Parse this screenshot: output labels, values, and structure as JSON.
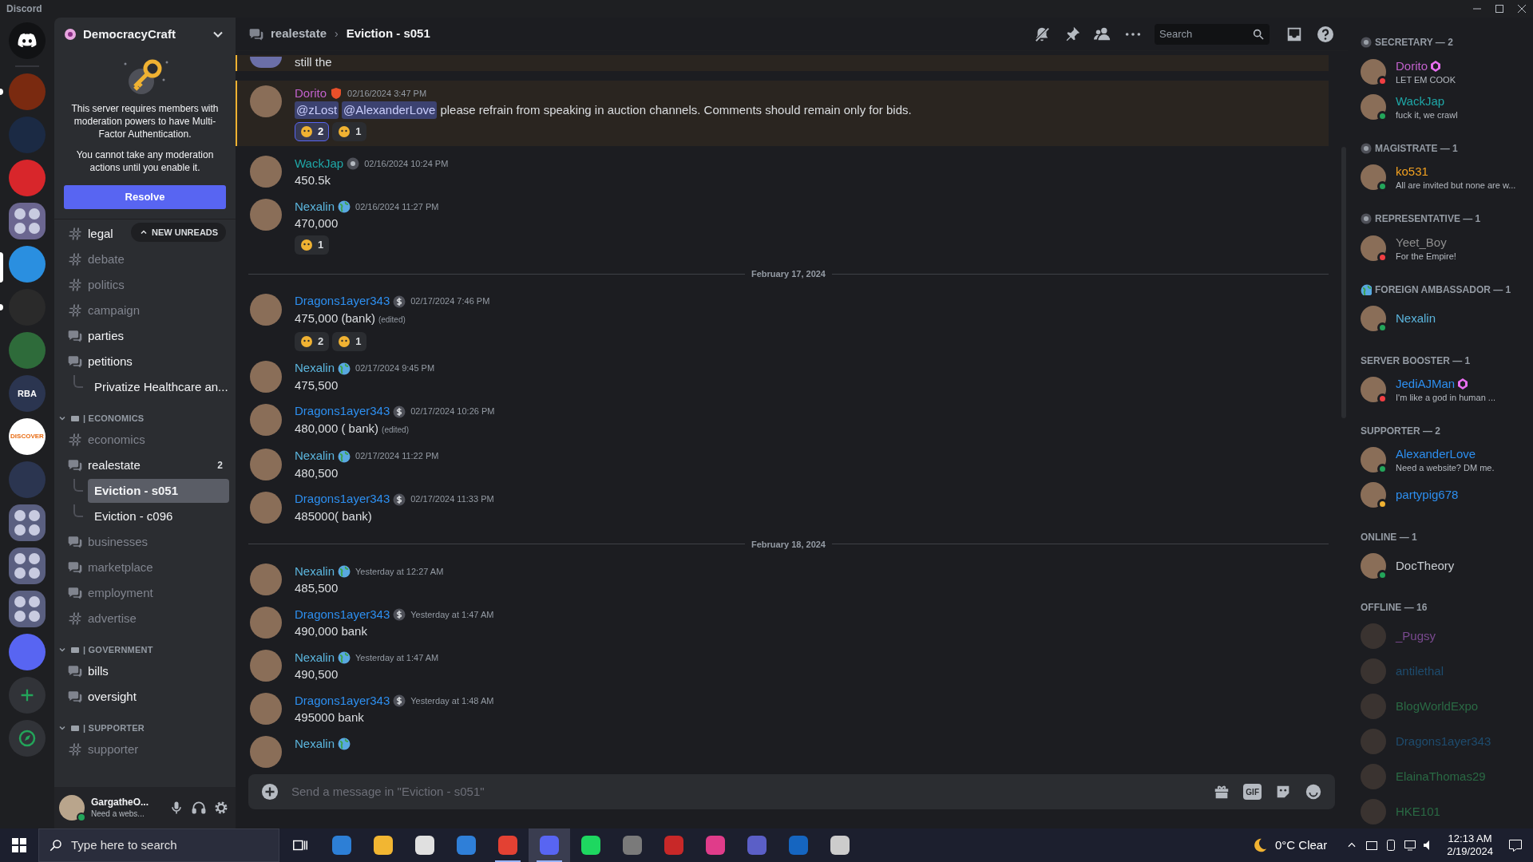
{
  "window": {
    "title": "Discord"
  },
  "servers": [
    {
      "color": "#7a2a10",
      "selected": false,
      "unread": true
    },
    {
      "color": "#1b2a44",
      "selected": false,
      "unread": false
    },
    {
      "color": "#d8262b",
      "selected": false,
      "unread": false
    },
    {
      "color": "#6b6690",
      "selected": false,
      "unread": false,
      "kind": "folder"
    },
    {
      "color": "#2a8fe0",
      "selected": true,
      "unread": false
    },
    {
      "color": "#2a2a2a",
      "selected": false,
      "unread": true
    },
    {
      "color": "#2e6b3a",
      "selected": false,
      "unread": false
    },
    {
      "color": "#2b3550",
      "selected": false,
      "unread": false,
      "label": "RBA"
    },
    {
      "color": "#ffffff",
      "selected": false,
      "unread": false,
      "label": "DISCOVER"
    },
    {
      "color": "#2b3550",
      "selected": false,
      "unread": false
    },
    {
      "color": "#5a5f80",
      "selected": false,
      "unread": false,
      "kind": "folder"
    },
    {
      "color": "#5a5f80",
      "selected": false,
      "unread": false,
      "kind": "folder"
    },
    {
      "color": "#5a5f80",
      "selected": false,
      "unread": false,
      "kind": "folder"
    },
    {
      "color": "#5865f2",
      "selected": false,
      "unread": false
    }
  ],
  "server": {
    "name": "DemocracyCraft",
    "notice": {
      "text": "This server requires members with moderation powers to have Multi-Factor Authentication.",
      "subtext": "You cannot take any moderation actions until you enable it.",
      "button": "Resolve"
    },
    "new_unreads": "NEW UNREADS",
    "channels": [
      {
        "kind": "text",
        "name": "legal",
        "unread": true,
        "selected": false
      },
      {
        "kind": "text",
        "name": "debate",
        "unread": false,
        "selected": false
      },
      {
        "kind": "text",
        "name": "politics",
        "unread": false,
        "selected": false
      },
      {
        "kind": "text",
        "name": "campaign",
        "unread": false,
        "selected": false
      },
      {
        "kind": "forum",
        "name": "parties",
        "unread": true,
        "selected": false
      },
      {
        "kind": "forum",
        "name": "petitions",
        "unread": true,
        "selected": false,
        "children": [
          {
            "name": "Privatize Healthcare an...",
            "unread": true,
            "selected": false
          }
        ]
      }
    ],
    "categories": [
      {
        "name": "| ECONOMICS",
        "expanded": true,
        "channels": [
          {
            "kind": "text",
            "name": "economics",
            "unread": false,
            "selected": false
          },
          {
            "kind": "forum",
            "name": "realestate",
            "unread": true,
            "selected": false,
            "badge": "2",
            "children": [
              {
                "name": "Eviction - s051",
                "unread": true,
                "selected": true
              },
              {
                "name": "Eviction - c096",
                "unread": true,
                "selected": false
              }
            ]
          },
          {
            "kind": "forum",
            "name": "businesses",
            "unread": false,
            "selected": false
          },
          {
            "kind": "forum",
            "name": "marketplace",
            "unread": false,
            "selected": false
          },
          {
            "kind": "forum",
            "name": "employment",
            "unread": false,
            "selected": false
          },
          {
            "kind": "text",
            "name": "advertise",
            "unread": false,
            "selected": false
          }
        ]
      },
      {
        "name": "| GOVERNMENT",
        "expanded": true,
        "channels": [
          {
            "kind": "forum",
            "name": "bills",
            "unread": true,
            "selected": false
          },
          {
            "kind": "forum",
            "name": "oversight",
            "unread": true,
            "selected": false
          }
        ]
      },
      {
        "name": "| SUPPORTER",
        "expanded": true,
        "channels": [
          {
            "kind": "text",
            "name": "supporter",
            "unread": false,
            "selected": false
          }
        ]
      }
    ]
  },
  "user_panel": {
    "name": "GargatheO...",
    "status_text": "Need a webs..."
  },
  "header": {
    "parent": "realestate",
    "separator": "›",
    "channel": "Eviction - s051",
    "search_placeholder": "Search"
  },
  "messages": [
    {
      "kind": "partial",
      "text": "still the"
    },
    {
      "kind": "message",
      "author": "Dorito",
      "color": "#c061cb",
      "badge": {
        "kind": "shield"
      },
      "time": "02/16/2024 3:47 PM",
      "highlighted": true,
      "mentions": [
        "@zLost",
        "@AlexanderLove"
      ],
      "text": "please refrain from speaking in auction channels. Comments should remain only for bids.",
      "reactions": [
        {
          "count": "2",
          "selected": true
        },
        {
          "count": "1",
          "selected": false
        }
      ]
    },
    {
      "kind": "message",
      "author": "WackJap",
      "color": "#1fa7a7",
      "badge": {
        "kind": "gear"
      },
      "time": "02/16/2024 10:24 PM",
      "highlighted": false,
      "text": "450.5k"
    },
    {
      "kind": "message",
      "author": "Nexalin",
      "color": "#5bb5dd",
      "badge": {
        "kind": "globe"
      },
      "time": "02/16/2024 11:27 PM",
      "highlighted": false,
      "text": "470,000",
      "reactions": [
        {
          "count": "1",
          "selected": false
        }
      ]
    },
    {
      "kind": "divider",
      "label": "February 17, 2024"
    },
    {
      "kind": "message",
      "author": "Dragons1ayer343",
      "color": "#2d8ff0",
      "badge": {
        "kind": "coin"
      },
      "time": "02/17/2024 7:46 PM",
      "highlighted": false,
      "text": "475,000 (bank)",
      "edited": "(edited)",
      "reactions": [
        {
          "count": "2",
          "selected": false
        },
        {
          "count": "1",
          "selected": false
        }
      ]
    },
    {
      "kind": "message",
      "author": "Nexalin",
      "color": "#5bb5dd",
      "badge": {
        "kind": "globe"
      },
      "time": "02/17/2024 9:45 PM",
      "highlighted": false,
      "text": "475,500"
    },
    {
      "kind": "message",
      "author": "Dragons1ayer343",
      "color": "#2d8ff0",
      "badge": {
        "kind": "coin"
      },
      "time": "02/17/2024 10:26 PM",
      "highlighted": false,
      "text": "480,000 ( bank)",
      "edited": "(edited)"
    },
    {
      "kind": "message",
      "author": "Nexalin",
      "color": "#5bb5dd",
      "badge": {
        "kind": "globe"
      },
      "time": "02/17/2024 11:22 PM",
      "highlighted": false,
      "text": "480,500"
    },
    {
      "kind": "message",
      "author": "Dragons1ayer343",
      "color": "#2d8ff0",
      "badge": {
        "kind": "coin"
      },
      "time": "02/17/2024 11:33 PM",
      "highlighted": false,
      "text": "485000( bank)"
    },
    {
      "kind": "divider",
      "label": "February 18, 2024"
    },
    {
      "kind": "message",
      "author": "Nexalin",
      "color": "#5bb5dd",
      "badge": {
        "kind": "globe"
      },
      "time": "Yesterday at 12:27 AM",
      "highlighted": false,
      "text": "485,500"
    },
    {
      "kind": "message",
      "author": "Dragons1ayer343",
      "color": "#2d8ff0",
      "badge": {
        "kind": "coin"
      },
      "time": "Yesterday at 1:47 AM",
      "highlighted": false,
      "text": "490,000 bank"
    },
    {
      "kind": "message",
      "author": "Nexalin",
      "color": "#5bb5dd",
      "badge": {
        "kind": "globe"
      },
      "time": "Yesterday at 1:47 AM",
      "highlighted": false,
      "text": "490,500"
    },
    {
      "kind": "message",
      "author": "Dragons1ayer343",
      "color": "#2d8ff0",
      "badge": {
        "kind": "coin"
      },
      "time": "Yesterday at 1:48 AM",
      "highlighted": false,
      "text": "495000 bank"
    },
    {
      "kind": "message",
      "author": "Nexalin",
      "color": "#5bb5dd",
      "badge": {
        "kind": "globe"
      },
      "highlighted": false
    }
  ],
  "composer": {
    "placeholder": "Send a message in \"Eviction - s051\"",
    "gif_label": "GIF"
  },
  "member_groups": [
    {
      "title": "SECRETARY — 2",
      "icon": {
        "kind": "role"
      },
      "members": [
        {
          "name": "Dorito",
          "color": "#c061cb",
          "kind": "dnd",
          "activity": "LET EM COOK",
          "booster": true
        },
        {
          "name": "WackJap",
          "color": "#1fa7a7",
          "kind": "online",
          "activity": "fuck it, we crawl"
        }
      ]
    },
    {
      "title": "MAGISTRATE — 1",
      "icon": {
        "kind": "role"
      },
      "members": [
        {
          "name": "ko531",
          "color": "#f1a020",
          "kind": "online",
          "activity": "All are invited but none are w..."
        }
      ]
    },
    {
      "title": "REPRESENTATIVE — 1",
      "icon": {
        "kind": "role"
      },
      "members": [
        {
          "name": "Yeet_Boy",
          "color": "#8e8e8e",
          "kind": "dnd",
          "activity": "For the Empire!"
        }
      ]
    },
    {
      "title": "FOREIGN AMBASSADOR — 1",
      "icon": {
        "kind": "globe"
      },
      "members": [
        {
          "name": "Nexalin",
          "color": "#5bb5dd",
          "kind": "online"
        }
      ]
    },
    {
      "title": "SERVER BOOSTER — 1",
      "members": [
        {
          "name": "JediAJMan",
          "color": "#2d8ff0",
          "kind": "dnd",
          "activity": "I'm like a god in human ...",
          "booster": true
        }
      ]
    },
    {
      "title": "SUPPORTER — 2",
      "members": [
        {
          "name": "AlexanderLove",
          "color": "#2d8ff0",
          "kind": "online",
          "activity": "Need a website? DM me."
        },
        {
          "name": "partypig678",
          "color": "#2d8ff0",
          "kind": "idle"
        }
      ]
    },
    {
      "title": "ONLINE — 1",
      "members": [
        {
          "name": "DocTheory",
          "color": "#c9cdd2",
          "kind": "online"
        }
      ]
    },
    {
      "title": "OFFLINE — 16",
      "members": [
        {
          "name": "_Pugsy",
          "color": "#7a4a90",
          "kind": "offline"
        },
        {
          "name": "antilethal",
          "color": "#1e4c6e",
          "kind": "offline"
        },
        {
          "name": "BlogWorldExpo",
          "color": "#2a6a44",
          "kind": "offline"
        },
        {
          "name": "Dragons1ayer343",
          "color": "#1e4c6e",
          "kind": "offline"
        },
        {
          "name": "ElainaThomas29",
          "color": "#2a6a44",
          "kind": "offline"
        },
        {
          "name": "HKE101",
          "color": "#2a6a44",
          "kind": "offline"
        }
      ]
    }
  ],
  "taskbar": {
    "search_placeholder": "Type here to search",
    "apps": [
      {
        "color": "#2d7fd6",
        "running": false,
        "selected": false
      },
      {
        "color": "#f2b632",
        "running": false,
        "selected": false
      },
      {
        "color": "#e0e0e0",
        "running": false,
        "selected": false
      },
      {
        "color": "#2f7fd8",
        "running": false,
        "selected": false
      },
      {
        "color": "#e34133",
        "running": true,
        "selected": false
      },
      {
        "color": "#5865f2",
        "running": true,
        "selected": true
      },
      {
        "color": "#1ed760",
        "running": false,
        "selected": false
      },
      {
        "color": "#7a7a7a",
        "running": false,
        "selected": false
      },
      {
        "color": "#c82828",
        "running": false,
        "selected": false
      },
      {
        "color": "#e03c8a",
        "running": false,
        "selected": false
      },
      {
        "color": "#5b5fc7",
        "running": false,
        "selected": false
      },
      {
        "color": "#1565c0",
        "running": false,
        "selected": false
      },
      {
        "color": "#cccccc",
        "running": false,
        "selected": false
      }
    ],
    "weather": "0°C Clear",
    "time": "12:13 AM",
    "date": "2/19/2024"
  }
}
